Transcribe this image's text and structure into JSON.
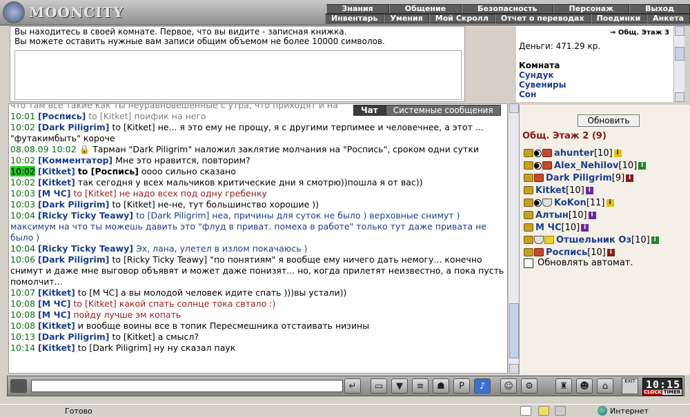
{
  "logo": {
    "text": "MOONCITY"
  },
  "menu_top": [
    "Знания",
    "Общение",
    "Безопасность",
    "Персонаж",
    "Выход"
  ],
  "menu_bottom": [
    "Инвентарь",
    "Умения",
    "Мой Скролл",
    "Отчет о переводах",
    "Поединки",
    "Анкета"
  ],
  "notebook": {
    "line1": "Вы находитесь в своей комнате. Первое, что вы видите - записная книжка.",
    "line2": "Вы можете оставить нужные вам записи общим объемом не более 10000 символов."
  },
  "info": {
    "location": "Общ. Этаж 3",
    "money": "Деньги: 471.29 кр.",
    "room_title": "Комната",
    "room_links": [
      "Сундук",
      "Сувениры",
      "Сон"
    ]
  },
  "chat_tabs": [
    "Чат",
    "Системные сообщения"
  ],
  "chat": [
    {
      "time": "",
      "parts": [
        {
          "c": "grey",
          "t": "что там все такие как ты неуравновешенные с утра, что приходят и на"
        }
      ]
    },
    {
      "time": "10:01",
      "parts": [
        {
          "c": "nick",
          "t": "[Роспись]"
        },
        {
          "c": "grey",
          "t": " to [Kitket] поифик на него"
        }
      ]
    },
    {
      "time": "10:02",
      "parts": [
        {
          "c": "nick",
          "t": "[Dark Piligrim]"
        },
        {
          "c": "",
          "t": " to [Kitket] не... я это ему не прощу, я с другими терпимее и человечнее, а этот ... \"футакимбыть\" короче"
        }
      ]
    },
    {
      "time": "08.08.09 10:02",
      "parts": [
        {
          "c": "",
          "t": " 🔒 Тарман \"Dark Piligrim\" наложил заклятие молчания на \"Роспись\", сроком одни сутки"
        }
      ]
    },
    {
      "time": "10:02",
      "parts": [
        {
          "c": "nick",
          "t": "[Комментатор]"
        },
        {
          "c": "",
          "t": " Мне это нравится, повторим?"
        }
      ]
    },
    {
      "time": "10:02",
      "hl": true,
      "parts": [
        {
          "c": "nick",
          "t": "[Kitket]"
        },
        {
          "c": "",
          "t": " "
        },
        {
          "c": "bold",
          "t": "to [Роспись]"
        },
        {
          "c": "",
          "t": " оооо сильно сказано"
        }
      ]
    },
    {
      "time": "10:02",
      "parts": [
        {
          "c": "nick",
          "t": "[Kitket]"
        },
        {
          "c": "",
          "t": " так сегодня у всех мальчиков критические дни я смотрю))пошла я от вас))"
        }
      ]
    },
    {
      "time": "10:03",
      "parts": [
        {
          "c": "nick",
          "t": "[М ЧС]"
        },
        {
          "c": "red",
          "t": " to [Kitket] не надо всех под одну гребенку"
        }
      ]
    },
    {
      "time": "10:03",
      "parts": [
        {
          "c": "nick",
          "t": "[Dark Piligrim]"
        },
        {
          "c": "",
          "t": " to [Kitket] не-не, тут большинство хорошие ))"
        }
      ]
    },
    {
      "time": "10:04",
      "parts": [
        {
          "c": "nick",
          "t": "[Ricky Ticky Teawy]"
        },
        {
          "c": "blue",
          "t": " to [Dark Piligrim] неа, причины для суток не было ) верховные снимут ) максимум на что ты можешь давить это \"флуд в приват. помеха в работе\" только тут даже привата не было )"
        }
      ]
    },
    {
      "time": "10:04",
      "parts": [
        {
          "c": "nick",
          "t": "[Ricky Ticky Teawy]"
        },
        {
          "c": "blue",
          "t": " Эх, лана, улетел в излом покачаюсь )"
        }
      ]
    },
    {
      "time": "10:06",
      "parts": [
        {
          "c": "nick",
          "t": "[Dark Piligrim]"
        },
        {
          "c": "",
          "t": " to [Ricky Ticky Teawy] \"по понятиям\" я вообще ему ничего дать немогу... конечно снимут и даже мне выговор объявят и может даже понизят... но, когда прилетят неизвестно, а пока пусть помолчит..."
        }
      ]
    },
    {
      "time": "10:07",
      "parts": [
        {
          "c": "nick",
          "t": "[Kitket]"
        },
        {
          "c": "",
          "t": " to [М ЧС] а вы молодой человек идите спать )))вы устали))"
        }
      ]
    },
    {
      "time": "10:08",
      "parts": [
        {
          "c": "nick",
          "t": "[М ЧС]"
        },
        {
          "c": "red",
          "t": " to [Kitket] какой спать солнце тока свтало :)"
        }
      ]
    },
    {
      "time": "10:08",
      "parts": [
        {
          "c": "nick",
          "t": "[М ЧС]"
        },
        {
          "c": "red",
          "t": " пойду лучше эм копать"
        }
      ]
    },
    {
      "time": "10:08",
      "parts": [
        {
          "c": "nick",
          "t": "[Kitket]"
        },
        {
          "c": "",
          "t": " и вообще воины все в топик Пересмешника отстаивать низины"
        }
      ]
    },
    {
      "time": "10:13",
      "parts": [
        {
          "c": "nick",
          "t": "[Dark Piligrim]"
        },
        {
          "c": "",
          "t": " to [Kitket] а смысл?"
        }
      ]
    },
    {
      "time": "10:14",
      "parts": [
        {
          "c": "nick",
          "t": "[Kitket]"
        },
        {
          "c": "",
          "t": " to [Dark Piligrim] ну ну сказал паук"
        }
      ]
    }
  ],
  "players_panel": {
    "refresh_label": "Обновить",
    "room_count": "Общ. Этаж 2 (9)",
    "auto_label": "Обновлять автомат.",
    "players": [
      {
        "name": "ahunter",
        "level": "[10]",
        "info": "i",
        "info_color": "yellow",
        "icons": [
          "hand",
          "yin",
          "clan"
        ]
      },
      {
        "name": "Alex_Nehilov",
        "level": "[10]",
        "info": "i",
        "info_color": "green",
        "icons": [
          "hand",
          "yin",
          "clan"
        ]
      },
      {
        "name": "Dark Piligrim",
        "level": "[9]",
        "info": "i",
        "info_color": "red",
        "icons": [
          "hand",
          "clan"
        ]
      },
      {
        "name": "Kitket",
        "level": "[10]",
        "info": "i",
        "info_color": "purple",
        "icons": [
          "hand"
        ]
      },
      {
        "name": "KoKon",
        "level": "[11]",
        "info": "i",
        "info_color": "yellow",
        "icons": [
          "hand",
          "yin",
          "shield"
        ]
      },
      {
        "name": "Алтын",
        "level": "[10]",
        "info": "i",
        "info_color": "purple",
        "icons": [
          "hand"
        ]
      },
      {
        "name": "М ЧС",
        "level": "[10]",
        "info": "i",
        "info_color": "purple",
        "icons": [
          "hand"
        ]
      },
      {
        "name": "Отшельник Оз",
        "level": "[10]",
        "info": "i",
        "info_color": "green",
        "icons": [
          "hand",
          "shield",
          "star"
        ]
      },
      {
        "name": "Роспись",
        "level": "[10]",
        "info": "i",
        "info_color": "red",
        "icons": [
          "hand",
          "clan"
        ]
      }
    ]
  },
  "toolbar": {
    "input_value": "",
    "exit_label": "EXIT",
    "clock": "10:15",
    "clock_label_left": "CLOCK",
    "clock_label_right": "TIMER"
  },
  "statusbar": {
    "text": "Готово",
    "zone": "Интернет"
  }
}
